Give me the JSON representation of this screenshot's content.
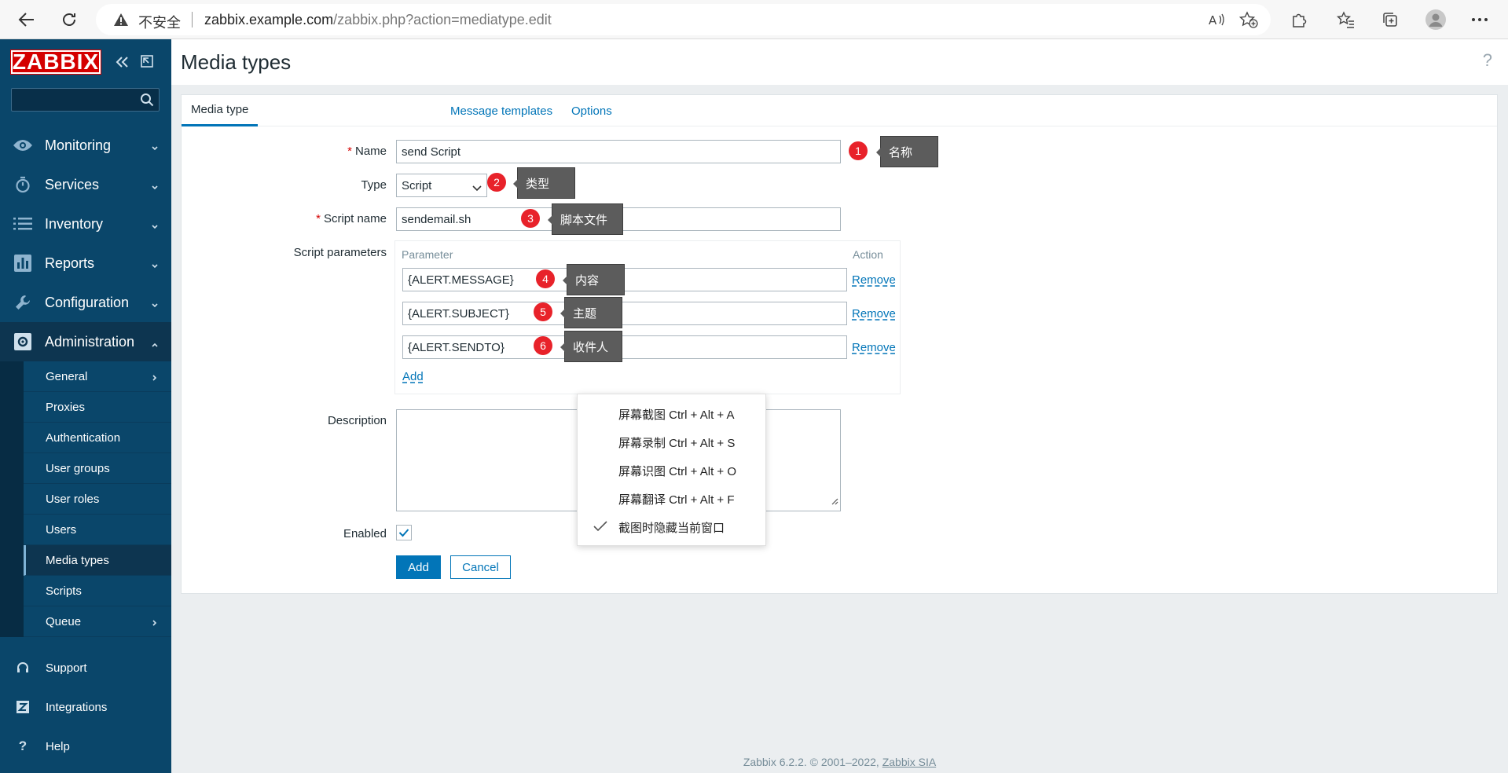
{
  "browser": {
    "insecure_label": "不安全",
    "url_host": "zabbix.example.com",
    "url_path": "/zabbix.php?action=mediatype.edit"
  },
  "sidebar": {
    "logo": "ZABBIX",
    "search_placeholder": "",
    "menu": [
      {
        "label": "Monitoring",
        "icon": "eye-icon"
      },
      {
        "label": "Services",
        "icon": "stopwatch-icon"
      },
      {
        "label": "Inventory",
        "icon": "list-icon"
      },
      {
        "label": "Reports",
        "icon": "bar-chart-icon"
      },
      {
        "label": "Configuration",
        "icon": "wrench-icon"
      },
      {
        "label": "Administration",
        "icon": "gear-icon"
      }
    ],
    "admin_submenu": [
      "General",
      "Proxies",
      "Authentication",
      "User groups",
      "User roles",
      "Users",
      "Media types",
      "Scripts",
      "Queue"
    ],
    "selected_submenu": "Media types",
    "bottom": [
      {
        "label": "Support",
        "icon": "headset-icon"
      },
      {
        "label": "Integrations",
        "icon": "z-icon"
      },
      {
        "label": "Help",
        "icon": "question-icon"
      }
    ]
  },
  "page": {
    "title": "Media types",
    "help": "?"
  },
  "tabs": [
    "Media type",
    "Message templates",
    "Options"
  ],
  "form": {
    "name_label": "Name",
    "name_value": "send Script",
    "type_label": "Type",
    "type_value": "Script",
    "script_name_label": "Script name",
    "script_name_value": "sendemail.sh",
    "params_label": "Script parameters",
    "param_header": "Parameter",
    "action_header": "Action",
    "params": [
      "{ALERT.MESSAGE}",
      "{ALERT.SUBJECT}",
      "{ALERT.SENDTO}"
    ],
    "remove_label": "Remove",
    "add_link": "Add",
    "description_label": "Description",
    "enabled_label": "Enabled",
    "enabled": true,
    "add_button": "Add",
    "cancel_button": "Cancel"
  },
  "annotations": [
    {
      "n": "1",
      "text": "名称"
    },
    {
      "n": "2",
      "text": "类型"
    },
    {
      "n": "3",
      "text": "脚本文件"
    },
    {
      "n": "4",
      "text": "内容"
    },
    {
      "n": "5",
      "text": "主题"
    },
    {
      "n": "6",
      "text": "收件人"
    }
  ],
  "context_menu": [
    "屏幕截图 Ctrl + Alt + A",
    "屏幕录制 Ctrl + Alt + S",
    "屏幕识图 Ctrl + Alt + O",
    "屏幕翻译 Ctrl + Alt + F",
    "截图时隐藏当前窗口"
  ],
  "footer": {
    "text": "Zabbix 6.2.2. © 2001–2022,",
    "link": "Zabbix SIA"
  },
  "colors": {
    "sidebar": "#0a466a",
    "accent": "#0275b8",
    "logo_red": "#d40000",
    "badge_red": "#e8222a"
  }
}
